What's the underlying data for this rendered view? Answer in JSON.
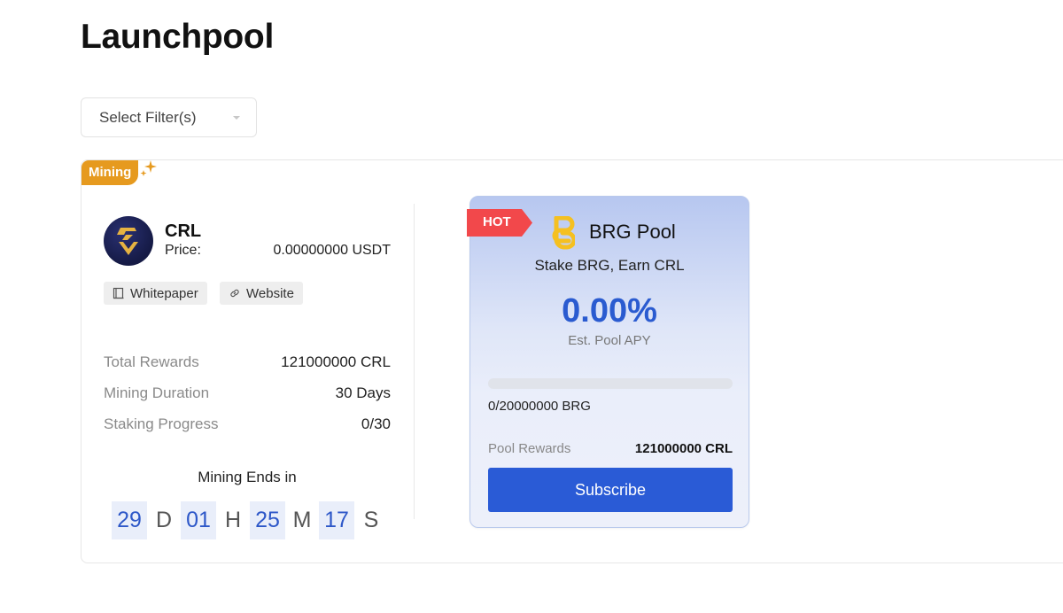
{
  "page": {
    "title": "Launchpool"
  },
  "filter": {
    "placeholder": "Select Filter(s)"
  },
  "project": {
    "tag": "Mining",
    "token": {
      "symbol": "CRL",
      "price_label": "Price:",
      "price_value": "0.00000000 USDT"
    },
    "links": [
      {
        "label": "Whitepaper",
        "icon": "book-icon"
      },
      {
        "label": "Website",
        "icon": "link-icon"
      }
    ],
    "stats": [
      {
        "label": "Total Rewards",
        "value": "121000000 CRL"
      },
      {
        "label": "Mining Duration",
        "value": "30 Days"
      },
      {
        "label": "Staking Progress",
        "value": "0/30"
      }
    ],
    "countdown": {
      "label": "Mining Ends in",
      "days": "29",
      "days_unit": "D",
      "hours": "01",
      "hours_unit": "H",
      "minutes": "25",
      "minutes_unit": "M",
      "seconds": "17",
      "seconds_unit": "S"
    }
  },
  "pool": {
    "badge": "HOT",
    "name": "BRG Pool",
    "subtitle": "Stake BRG, Earn CRL",
    "apy_value": "0.00%",
    "apy_label": "Est. Pool APY",
    "progress_fraction": 0,
    "staked_text": "0/20000000 BRG",
    "rewards_label": "Pool Rewards",
    "rewards_value": "121000000 CRL",
    "subscribe_label": "Subscribe"
  },
  "colors": {
    "accent_blue": "#2a5bd6",
    "mining_orange": "#e69a1f",
    "hot_red": "#f2484b",
    "brg_yellow": "#f5c020"
  }
}
